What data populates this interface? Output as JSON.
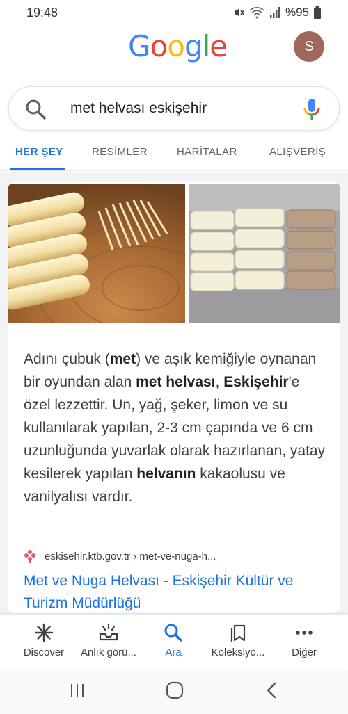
{
  "status_bar": {
    "time": "19:48",
    "battery": "%95"
  },
  "header": {
    "logo": [
      "G",
      "o",
      "o",
      "g",
      "l",
      "e"
    ],
    "logo_colors": [
      "#4285f4",
      "#ea4335",
      "#fbbc05",
      "#4285f4",
      "#34a853",
      "#ea4335"
    ],
    "avatar_letter": "S",
    "avatar_color": "#a0685a"
  },
  "search": {
    "query": "met helvası eskişehir"
  },
  "tabs": [
    {
      "label": "HER ŞEY",
      "active": true
    },
    {
      "label": "RESİMLER",
      "active": false
    },
    {
      "label": "HARİTALAR",
      "active": false
    },
    {
      "label": "ALIŞVERİŞ",
      "active": false
    }
  ],
  "snippet": {
    "segments": [
      {
        "t": "Adını çubuk (",
        "b": false
      },
      {
        "t": "met",
        "b": true
      },
      {
        "t": ") ve aşık kemiğiyle oynanan bir oyundan alan ",
        "b": false
      },
      {
        "t": "met helvası",
        "b": true
      },
      {
        "t": ", ",
        "b": false
      },
      {
        "t": "Eskişehir",
        "b": true
      },
      {
        "t": "'e özel lezzettir. Un, yağ, şeker, limon ve su kullanılarak yapılan, 2-3 cm çapında ve 6 cm uzunluğunda yuvarlak olarak hazırlanan, yatay kesilerek yapılan ",
        "b": false
      },
      {
        "t": "helvanın",
        "b": true
      },
      {
        "t": " kakaolusu ve vanilyalısı vardır.",
        "b": false
      }
    ]
  },
  "source": {
    "url": "eskisehir.ktb.gov.tr › met-ve-nuga-h...",
    "title": "Met ve Nuga Helvası - Eskişehir Kültür ve Turizm Müdürlüğü"
  },
  "bottom_nav": [
    {
      "label": "Discover",
      "icon": "asterisk-icon",
      "active": false
    },
    {
      "label": "Anlık görü...",
      "icon": "inbox-updates-icon",
      "active": false
    },
    {
      "label": "Ara",
      "icon": "search-icon",
      "active": true
    },
    {
      "label": "Koleksiyo...",
      "icon": "collections-icon",
      "active": false
    },
    {
      "label": "Diğer",
      "icon": "more-dots-icon",
      "active": false
    }
  ],
  "colors": {
    "accent": "#1a73e8",
    "link": "#1a73e8"
  }
}
